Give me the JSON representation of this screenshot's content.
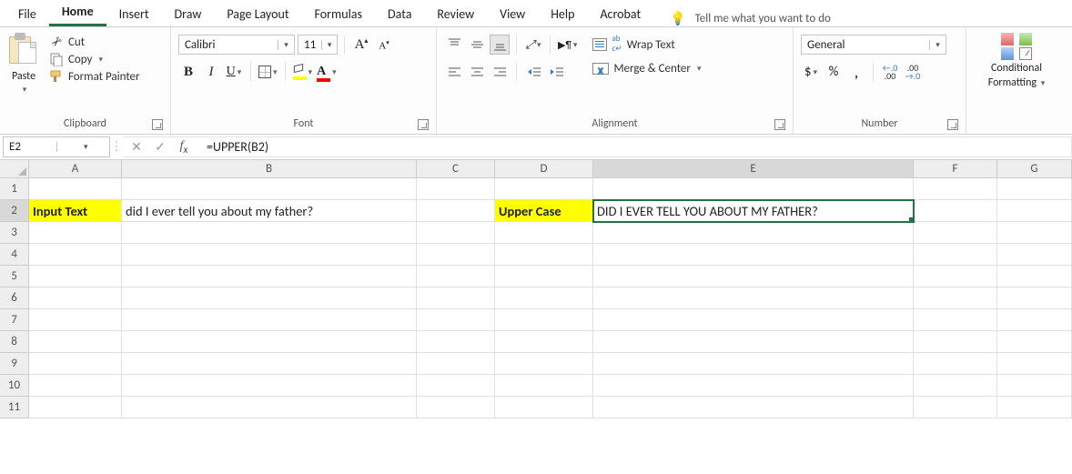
{
  "tabs": {
    "items": [
      "File",
      "Home",
      "Insert",
      "Draw",
      "Page Layout",
      "Formulas",
      "Data",
      "Review",
      "View",
      "Help",
      "Acrobat"
    ],
    "active": "Home",
    "tell_me": "Tell me what you want to do"
  },
  "ribbon": {
    "clipboard": {
      "label": "Clipboard",
      "paste": "Paste",
      "cut": "Cut",
      "copy": "Copy",
      "format_painter": "Format Painter"
    },
    "font": {
      "label": "Font",
      "name": "Calibri",
      "size": "11"
    },
    "alignment": {
      "label": "Alignment",
      "wrap": "Wrap Text",
      "merge": "Merge & Center"
    },
    "number": {
      "label": "Number",
      "format": "General"
    },
    "conditional": {
      "line1": "Conditional",
      "line2": "Formatting"
    }
  },
  "formula_bar": {
    "cell_ref": "E2",
    "formula": "=UPPER(B2)"
  },
  "columns": [
    "A",
    "B",
    "C",
    "D",
    "E",
    "F",
    "G"
  ],
  "rows": [
    "1",
    "2",
    "3",
    "4",
    "5",
    "6",
    "7",
    "8",
    "9",
    "10",
    "11"
  ],
  "cells": {
    "A2": "Input Text",
    "B2": "did I ever tell you about my father?",
    "D2": "Upper Case",
    "E2": "DID I EVER TELL YOU ABOUT MY FATHER?"
  },
  "selected_cell": "E2"
}
